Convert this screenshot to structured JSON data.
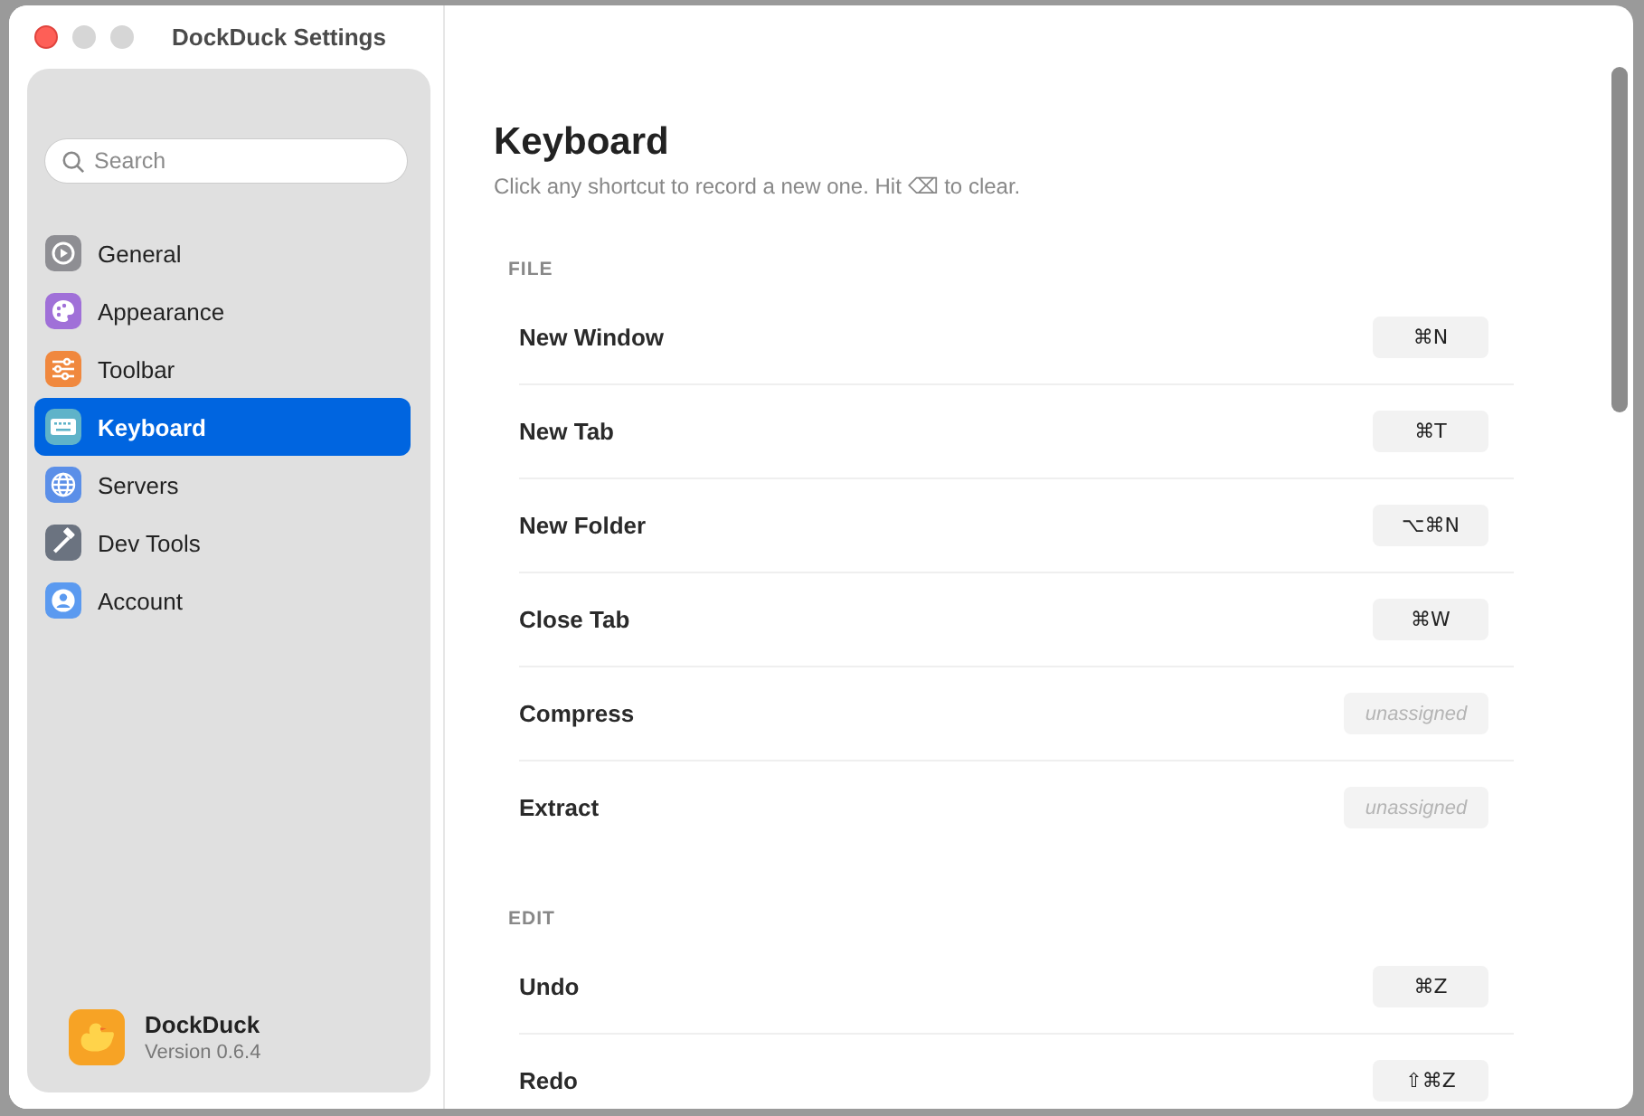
{
  "window": {
    "title": "DockDuck Settings"
  },
  "sidebar": {
    "search": {
      "placeholder": "Search"
    },
    "items": [
      {
        "label": "General",
        "kind": "gear",
        "color": "#8e8e93",
        "selected": false
      },
      {
        "label": "Appearance",
        "kind": "palette",
        "color": "#a070d8",
        "selected": false
      },
      {
        "label": "Toolbar",
        "kind": "sliders",
        "color": "#f0883e",
        "selected": false
      },
      {
        "label": "Keyboard",
        "kind": "keyboard",
        "color": "#5fb3c9",
        "selected": true
      },
      {
        "label": "Servers",
        "kind": "globe",
        "color": "#5b8fe8",
        "selected": false
      },
      {
        "label": "Dev Tools",
        "kind": "hammer",
        "color": "#6b7380",
        "selected": false
      },
      {
        "label": "Account",
        "kind": "person",
        "color": "#5b9af0",
        "selected": false
      }
    ],
    "app": {
      "name": "DockDuck",
      "version": "Version 0.6.4"
    }
  },
  "main": {
    "title": "Keyboard",
    "subtitle": "Click any shortcut to record a new one. Hit ⌫ to clear.",
    "sections": [
      {
        "heading": "FILE",
        "rows": [
          {
            "label": "New Window",
            "shortcut": "⌘N",
            "assigned": true
          },
          {
            "label": "New Tab",
            "shortcut": "⌘T",
            "assigned": true
          },
          {
            "label": "New Folder",
            "shortcut": "⌥⌘N",
            "assigned": true
          },
          {
            "label": "Close Tab",
            "shortcut": "⌘W",
            "assigned": true
          },
          {
            "label": "Compress",
            "shortcut": "unassigned",
            "assigned": false
          },
          {
            "label": "Extract",
            "shortcut": "unassigned",
            "assigned": false
          }
        ]
      },
      {
        "heading": "EDIT",
        "rows": [
          {
            "label": "Undo",
            "shortcut": "⌘Z",
            "assigned": true
          },
          {
            "label": "Redo",
            "shortcut": "⇧⌘Z",
            "assigned": true
          }
        ]
      }
    ]
  }
}
